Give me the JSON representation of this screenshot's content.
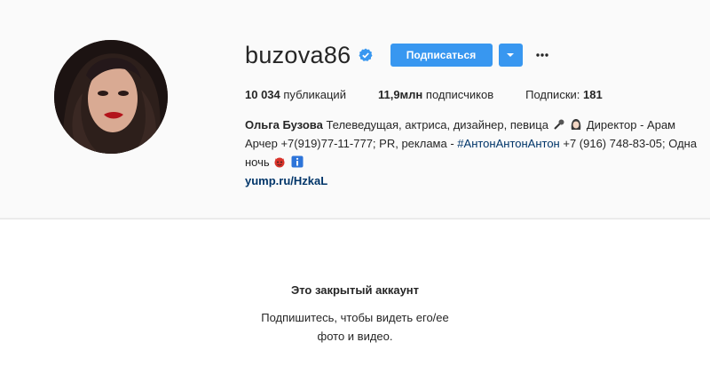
{
  "profile": {
    "username": "buzova86",
    "follow_label": "Подписаться",
    "stats": {
      "posts_value": "10 034",
      "posts_label": "публикаций",
      "followers_value": "11,9млн",
      "followers_label": "подписчиков",
      "following_label": "Подписки:",
      "following_value": "181"
    },
    "bio": {
      "name": "Ольга Бузова",
      "line1": "Телеведущая, актриса, дизайнер, певица",
      "line1b": "Директор - Арам",
      "line2": "Арчер +7(919)77-11-777; PR, реклама -",
      "hashtag": "#АнтонАнтонАнтон",
      "line2b": "+7 (916) 748-83-05;",
      "line3": "Одна ночь",
      "link": "yump.ru/HzkaL"
    }
  },
  "private_notice": {
    "title": "Это закрытый аккаунт",
    "subtitle_line1": "Подпишитесь, чтобы видеть его/ее",
    "subtitle_line2": "фото и видео."
  },
  "icons": {
    "verified": "verified-badge-icon",
    "dropdown": "chevron-down-icon",
    "more": "more-options-icon",
    "microphone": "microphone-emoji",
    "woman": "woman-emoji",
    "devil": "devil-emoji",
    "info": "info-emoji"
  },
  "colors": {
    "accent": "#3897f0",
    "link": "#003569",
    "text": "#262626",
    "background": "#fafafa"
  }
}
